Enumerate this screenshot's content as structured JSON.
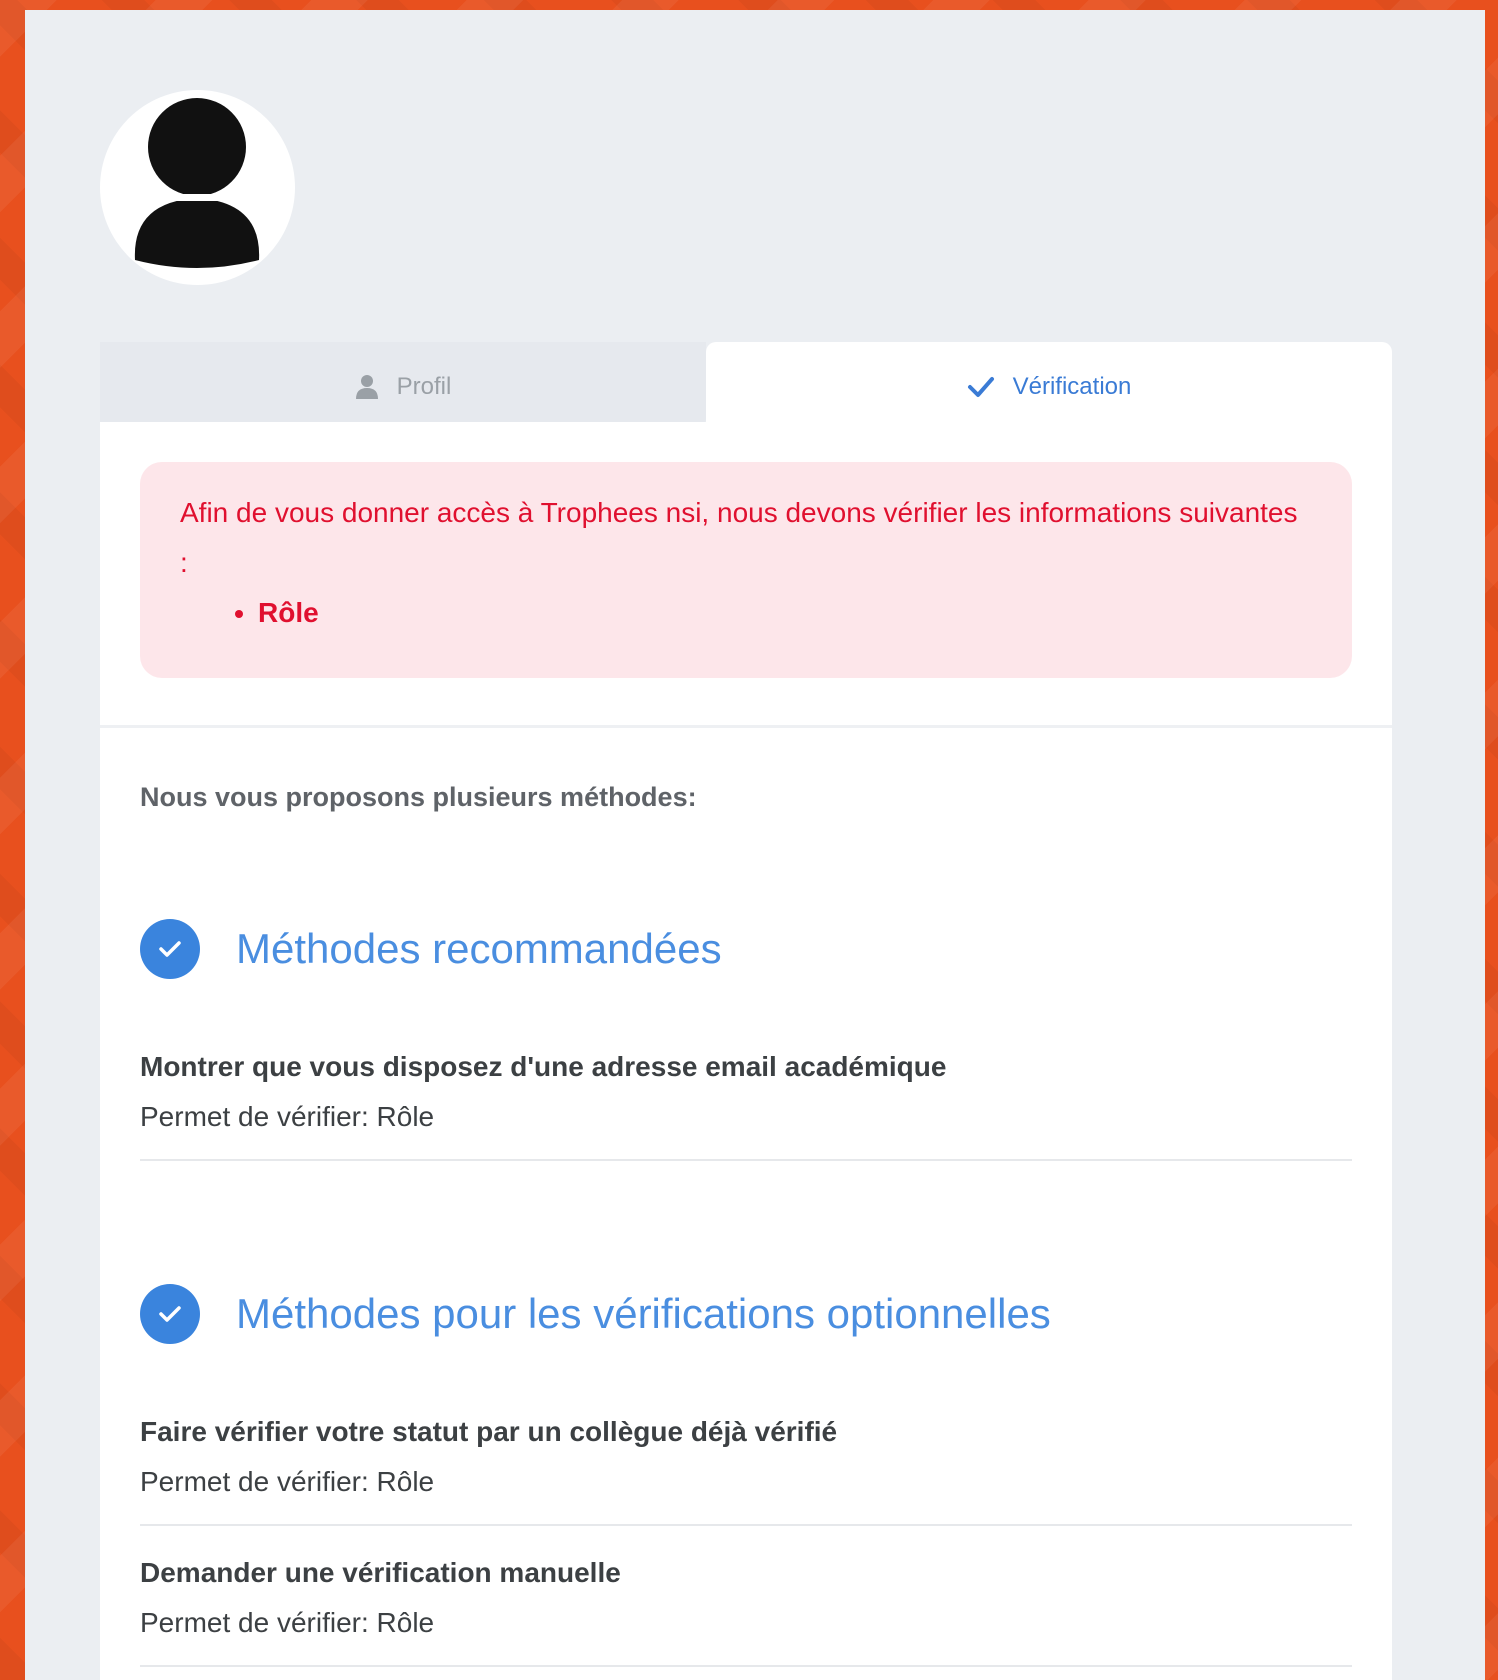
{
  "tabs": {
    "profil": "Profil",
    "verification": "Vérification"
  },
  "alert": {
    "text": "Afin de vous donner accès à Trophees nsi, nous devons vérifier les informations suivantes :",
    "items": [
      "Rôle"
    ]
  },
  "intro": "Nous vous proposons plusieurs méthodes:",
  "sections": [
    {
      "title": "Méthodes recommandées",
      "methods": [
        {
          "title": "Montrer que vous disposez d'une adresse email académique",
          "subtitle": "Permet de vérifier: Rôle"
        }
      ]
    },
    {
      "title": "Méthodes pour les vérifications optionnelles",
      "methods": [
        {
          "title": "Faire vérifier votre statut par un collègue déjà vérifié",
          "subtitle": "Permet de vérifier: Rôle"
        },
        {
          "title": "Demander une vérification manuelle",
          "subtitle": "Permet de vérifier: Rôle"
        }
      ]
    }
  ],
  "colors": {
    "background": "#e8501e",
    "accent": "#3a84dd",
    "alert_text": "#e0102f",
    "alert_bg": "#fde6ea"
  },
  "icons": {
    "avatar": "user-avatar-icon",
    "profil_tab": "user-icon",
    "verification_tab": "check-icon",
    "section": "check-circle-icon"
  }
}
